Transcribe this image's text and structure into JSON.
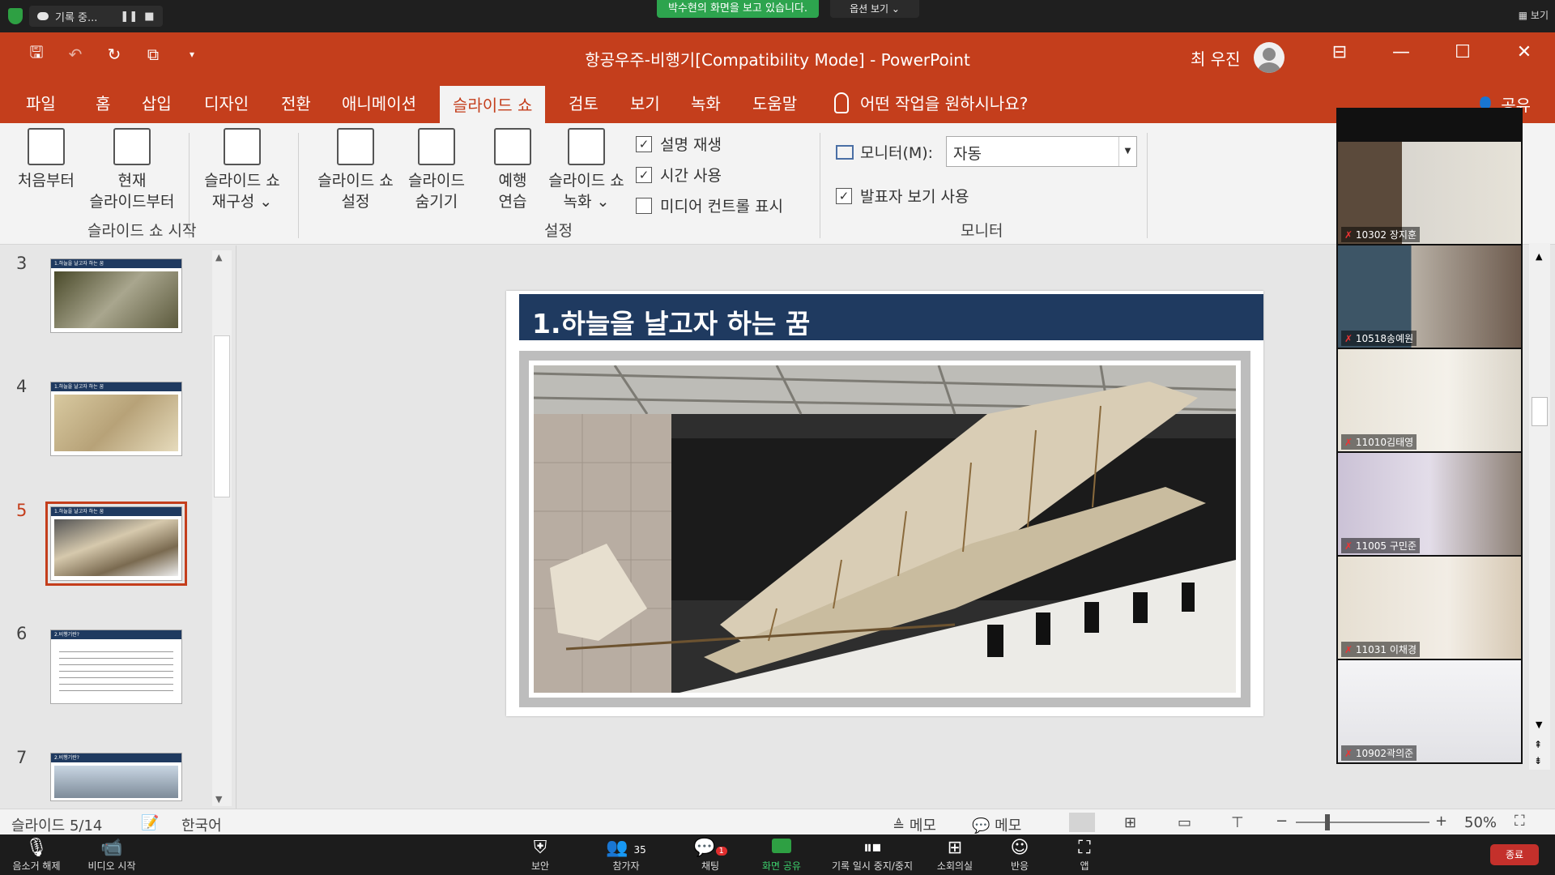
{
  "zoom": {
    "rec_label": "기록 중...",
    "share_banner": "박수현의 화면을 보고 있습니다.",
    "view_options": "옵션 보기",
    "view_label": "보기",
    "bottom": [
      {
        "icon": "mic-muted-icon",
        "label": "음소거 해제"
      },
      {
        "icon": "video-off-icon",
        "label": "비디오 시작"
      },
      {
        "icon": "shield-icon",
        "label": "보안"
      },
      {
        "icon": "participants-icon",
        "label": "참가자",
        "count": "35"
      },
      {
        "icon": "chat-icon",
        "label": "채팅",
        "badge": "1"
      },
      {
        "icon": "share-screen-icon",
        "label": "화면 공유"
      },
      {
        "icon": "record-icon",
        "label": "기록 일시 중지/중지"
      },
      {
        "icon": "breakout-icon",
        "label": "소회의실"
      },
      {
        "icon": "reactions-icon",
        "label": "반응"
      },
      {
        "icon": "apps-icon",
        "label": "앱"
      }
    ],
    "end": "종료"
  },
  "ppt": {
    "title": "항공우주-비행기[Compatibility Mode]  -  PowerPoint",
    "user": "최 우진",
    "tabs": [
      "파일",
      "홈",
      "삽입",
      "디자인",
      "전환",
      "애니메이션",
      "슬라이드 쇼",
      "검토",
      "보기",
      "녹화",
      "도움말"
    ],
    "active_tab": "슬라이드 쇼",
    "tell_me": "어떤 작업을 원하시나요?",
    "share": "공유",
    "ribbon": {
      "from_start": "처음부터",
      "from_current_1": "현재",
      "from_current_2": "슬라이드부터",
      "custom_1": "슬라이드 쇼",
      "custom_2": "재구성",
      "group_start": "슬라이드 쇼 시작",
      "setup_1": "슬라이드 쇼",
      "setup_2": "설정",
      "hide_1": "슬라이드",
      "hide_2": "숨기기",
      "rehearse_1": "예행",
      "rehearse_2": "연습",
      "record_1": "슬라이드 쇼",
      "record_2": "녹화",
      "chk_narration": "설명 재생",
      "chk_timing": "시간 사용",
      "chk_media": "미디어 컨트롤 표시",
      "group_setup": "설정",
      "monitor_label": "모니터(M):",
      "monitor_value": "자동",
      "presenter_view": "발표자 보기 사용",
      "group_monitor": "모니터"
    },
    "thumbs": [
      {
        "num": "3",
        "hdr": "1.하늘을 날고자 하는 꿈"
      },
      {
        "num": "4",
        "hdr": "1.하늘을 날고자 하는 꿈"
      },
      {
        "num": "5",
        "hdr": "1.하늘을 날고자 하는 꿈"
      },
      {
        "num": "6",
        "hdr": "2.비행기란?"
      },
      {
        "num": "7",
        "hdr": "2.비행기란?"
      }
    ],
    "slide_title": "1.하늘을 날고자 하는 꿈",
    "status": {
      "slide": "슬라이드 5/14",
      "lang": "한국어",
      "notes": "메모",
      "comments": "메모",
      "zoom": "50%"
    }
  },
  "participants": [
    {
      "name": "10302 장지훈"
    },
    {
      "name": "10518송예원"
    },
    {
      "name": "11010김태영"
    },
    {
      "name": "11005 구민준"
    },
    {
      "name": "11031 이채경"
    },
    {
      "name": "10902곽의준"
    }
  ]
}
